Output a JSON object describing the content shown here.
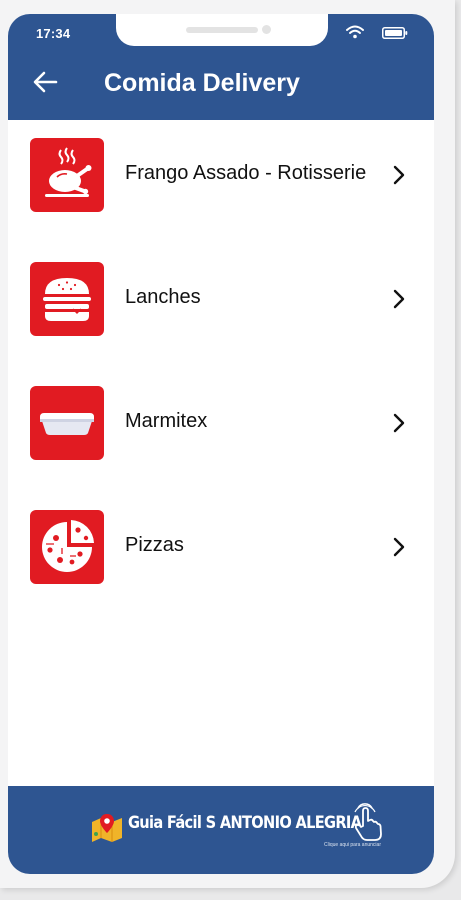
{
  "status_bar": {
    "time": "17:34"
  },
  "header": {
    "title": "Comida Delivery"
  },
  "categories": [
    {
      "label": "Frango Assado - Rotisserie",
      "icon": "roast-chicken-icon"
    },
    {
      "label": "Lanches",
      "icon": "burger-icon"
    },
    {
      "label": "Marmitex",
      "icon": "lunch-box-icon"
    },
    {
      "label": "Pizzas",
      "icon": "pizza-icon"
    }
  ],
  "footer": {
    "brand": "Guia Fácil S ANTONIO ALEGRIA",
    "caption": "Clique aqui para anunciar"
  },
  "colors": {
    "primary": "#2e5591",
    "accent": "#e11b22",
    "background": "#ffffff"
  }
}
